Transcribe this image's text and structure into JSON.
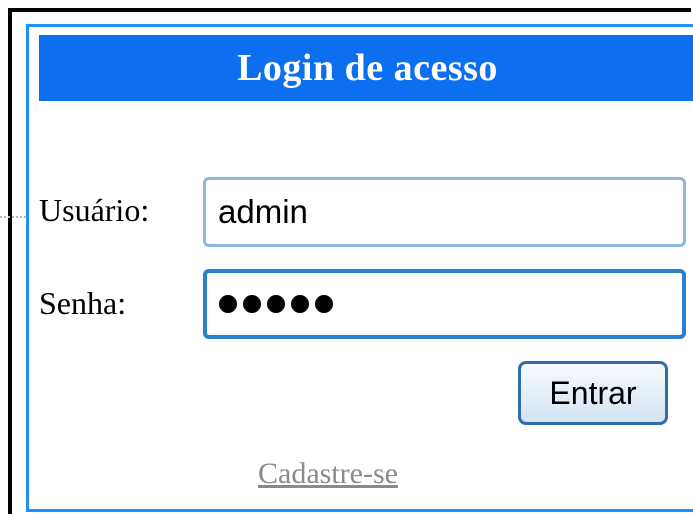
{
  "login": {
    "title": "Login de acesso",
    "username_label": "Usuário:",
    "username_value": "admin",
    "password_label": "Senha:",
    "password_mask_length": 5,
    "submit_label": "Entrar",
    "register_link": "Cadastre-se"
  },
  "colors": {
    "header_bg": "#0b6ff0",
    "panel_border": "#1e90ff",
    "link": "#8a8a8a"
  }
}
